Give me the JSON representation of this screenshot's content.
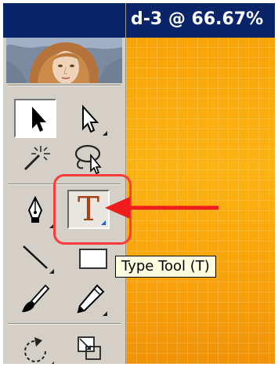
{
  "document": {
    "title": "d-3 @ 66.67%"
  },
  "toolbox": {
    "header_image": "venus-portrait",
    "tools": [
      {
        "name": "Selection Tool",
        "icon": "selection-arrow-icon"
      },
      {
        "name": "Direct Selection Tool",
        "icon": "direct-selection-icon"
      },
      {
        "name": "Magic Wand Tool",
        "icon": "magic-wand-icon"
      },
      {
        "name": "Lasso Tool",
        "icon": "lasso-icon"
      },
      {
        "name": "Pen Tool",
        "icon": "pen-icon"
      },
      {
        "name": "Type Tool",
        "icon": "type-icon",
        "glyph": "T"
      },
      {
        "name": "Line Segment Tool",
        "icon": "line-segment-icon"
      },
      {
        "name": "Rectangle Tool",
        "icon": "rectangle-icon"
      },
      {
        "name": "Paintbrush Tool",
        "icon": "paintbrush-icon"
      },
      {
        "name": "Pencil Tool",
        "icon": "pencil-icon"
      },
      {
        "name": "Rotate Tool",
        "icon": "rotate-icon"
      },
      {
        "name": "Scale Tool",
        "icon": "scale-icon"
      }
    ]
  },
  "tooltip": {
    "text": "Type Tool (T)"
  },
  "annotation": {
    "highlight_color": "#ff3b3b",
    "arrow_color": "#ee1c1c",
    "canvas_color": "#f9a90f",
    "titlebar_color": "#0a246a"
  }
}
